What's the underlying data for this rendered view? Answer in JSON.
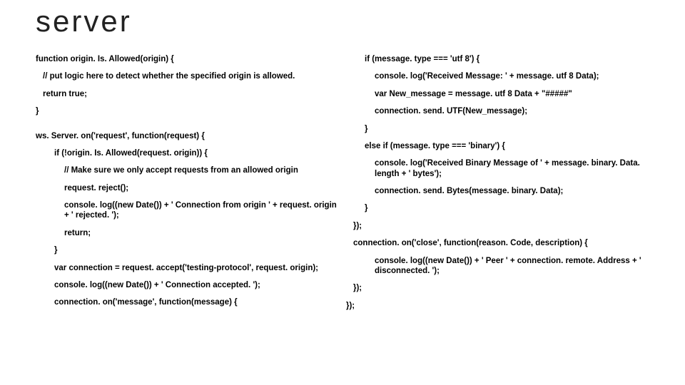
{
  "title": "server",
  "left": {
    "l1": "function origin. Is. Allowed(origin) {",
    "l2": "// put logic here to detect whether the specified origin is allowed.",
    "l3": "return true;",
    "l4": "}",
    "l5": "ws. Server. on('request', function(request) {",
    "l6": "if (!origin. Is. Allowed(request. origin)) {",
    "l7": "// Make sure we only accept requests from an allowed origin",
    "l8": "request. reject();",
    "l9": "console. log((new Date()) + ' Connection from origin ' + request. origin + ' rejected. ');",
    "l10": "return;",
    "l11": "}",
    "l12": "var connection = request. accept('testing-protocol', request. origin);",
    "l13": "console. log((new Date()) + ' Connection accepted. ');",
    "l14": "connection. on('message', function(message) {"
  },
  "right": {
    "r1": "if (message. type === 'utf 8') {",
    "r2": "console. log('Received Message: ' + message. utf 8 Data);",
    "r3": "var New_message = message. utf 8 Data + \"#####\"",
    "r4": "connection. send. UTF(New_message);",
    "r5": "}",
    "r6": "else if (message. type === 'binary') {",
    "r7": "console. log('Received Binary Message of ' + message. binary. Data. length + ' bytes');",
    "r8": "connection. send. Bytes(message. binary. Data);",
    "r9": "}",
    "r10": "});",
    "r11": "connection. on('close', function(reason. Code, description) {",
    "r12": "console. log((new Date()) + ' Peer ' + connection. remote. Address + ' disconnected. ');",
    "r13": "});",
    "r14": "});"
  }
}
